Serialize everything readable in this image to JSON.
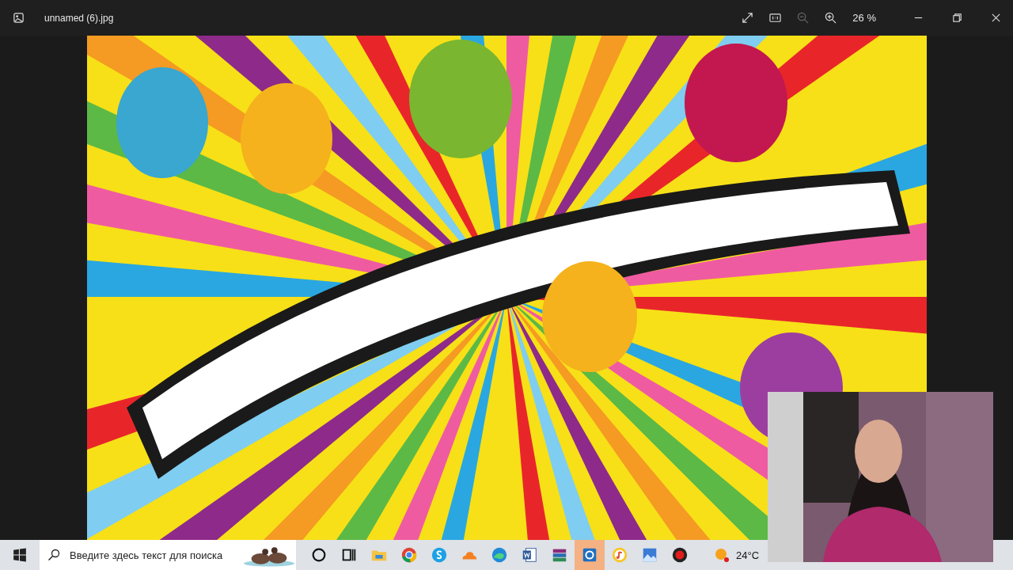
{
  "window": {
    "title": "unnamed (6).jpg"
  },
  "toolbar": {
    "zoom": "26 %"
  },
  "taskbar": {
    "search": {
      "placeholder": "Введите здесь текст для поиска"
    },
    "apps": [
      {
        "kind": "cortana",
        "selected": false
      },
      {
        "kind": "taskview",
        "selected": false
      },
      {
        "kind": "folder",
        "selected": false
      },
      {
        "kind": "browser",
        "selected": false
      },
      {
        "kind": "chat",
        "selected": false
      },
      {
        "kind": "cloud",
        "selected": false
      },
      {
        "kind": "edge",
        "selected": false
      },
      {
        "kind": "document",
        "selected": false
      },
      {
        "kind": "archive",
        "selected": false
      },
      {
        "kind": "media",
        "selected": true
      },
      {
        "kind": "music",
        "selected": false
      },
      {
        "kind": "photos",
        "selected": false
      },
      {
        "kind": "record",
        "selected": false
      }
    ],
    "weather": "24°C"
  }
}
